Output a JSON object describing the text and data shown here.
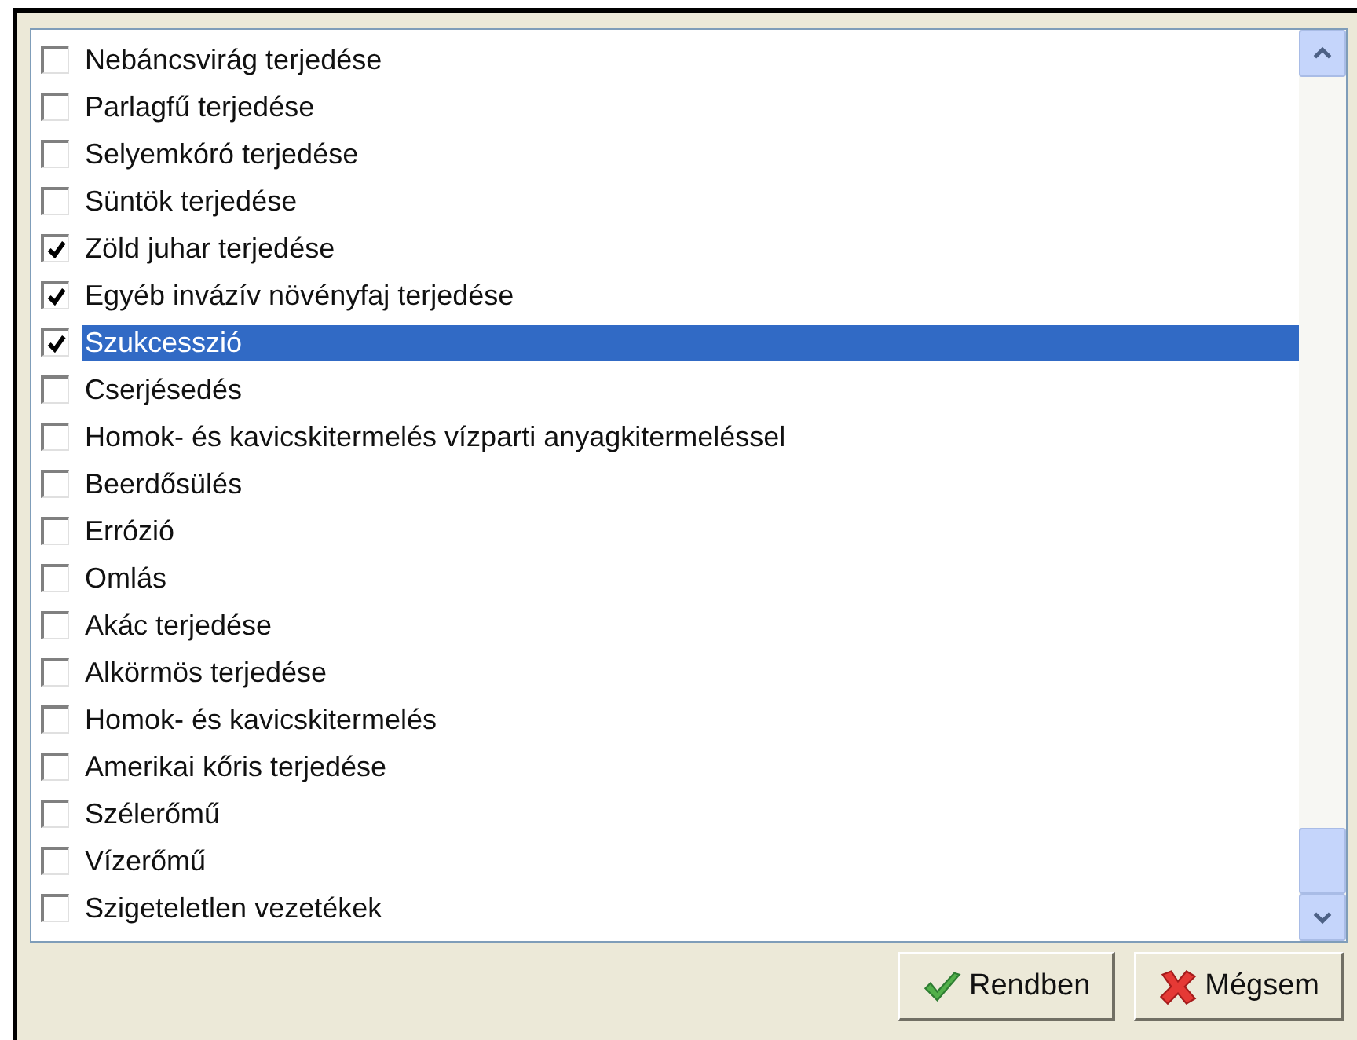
{
  "items": [
    {
      "label": "Nebáncsvirág terjedése",
      "checked": false,
      "selected": false
    },
    {
      "label": "Parlagfű terjedése",
      "checked": false,
      "selected": false
    },
    {
      "label": "Selyemkóró terjedése",
      "checked": false,
      "selected": false
    },
    {
      "label": "Süntök terjedése",
      "checked": false,
      "selected": false
    },
    {
      "label": "Zöld juhar terjedése",
      "checked": true,
      "selected": false
    },
    {
      "label": "Egyéb invázív növényfaj terjedése",
      "checked": true,
      "selected": false
    },
    {
      "label": "Szukcesszió",
      "checked": true,
      "selected": true
    },
    {
      "label": "Cserjésedés",
      "checked": false,
      "selected": false
    },
    {
      "label": "Homok- és kavicskitermelés vízparti anyagkitermeléssel",
      "checked": false,
      "selected": false
    },
    {
      "label": "Beerdősülés",
      "checked": false,
      "selected": false
    },
    {
      "label": "Errózió",
      "checked": false,
      "selected": false
    },
    {
      "label": "Omlás",
      "checked": false,
      "selected": false
    },
    {
      "label": "Akác terjedése",
      "checked": false,
      "selected": false
    },
    {
      "label": "Alkörmös terjedése",
      "checked": false,
      "selected": false
    },
    {
      "label": "Homok- és kavicskitermelés",
      "checked": false,
      "selected": false
    },
    {
      "label": "Amerikai kőris terjedése",
      "checked": false,
      "selected": false
    },
    {
      "label": "Szélerőmű",
      "checked": false,
      "selected": false
    },
    {
      "label": "Vízerőmű",
      "checked": false,
      "selected": false
    },
    {
      "label": "Szigeteletlen vezetékek",
      "checked": false,
      "selected": false
    }
  ],
  "buttons": [
    {
      "label": "Rendben",
      "kind": "ok"
    },
    {
      "label": "Mégsem",
      "kind": "cancel"
    }
  ]
}
